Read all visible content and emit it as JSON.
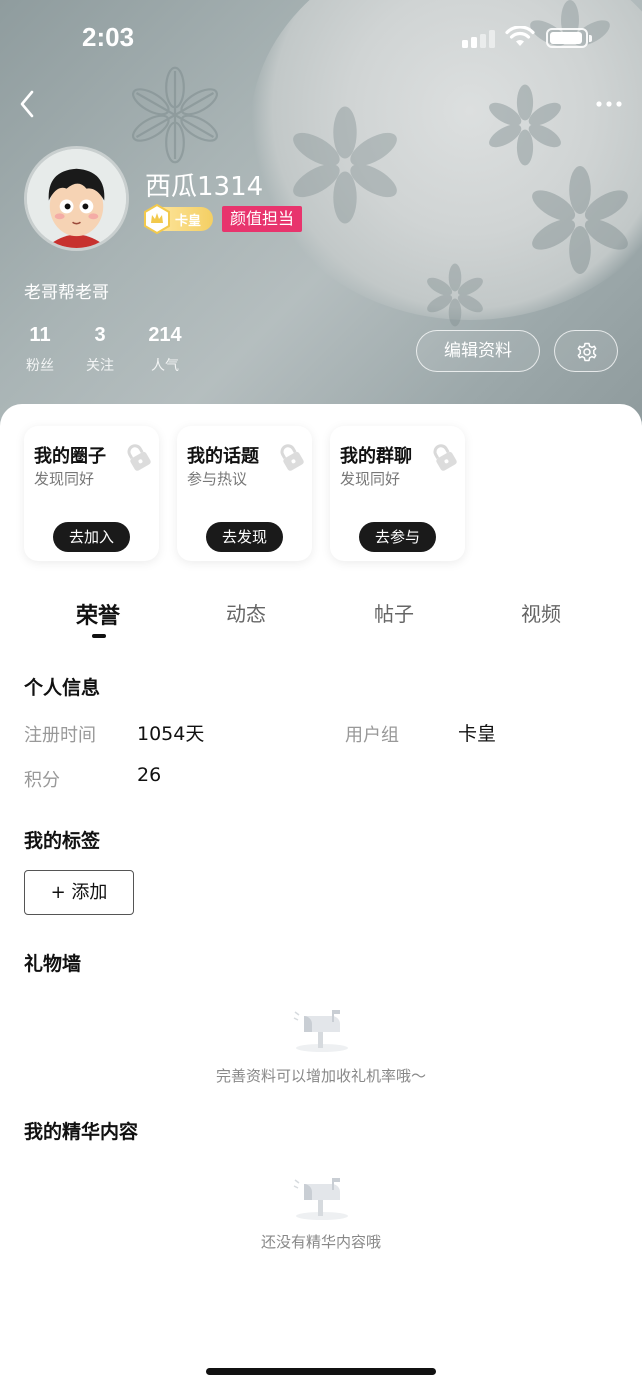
{
  "status_bar": {
    "time": "2:03"
  },
  "profile": {
    "username": "西瓜1314",
    "vip_badge": "卡皇",
    "honor_badge": "颜值担当",
    "bio": "老哥帮老哥",
    "stats": [
      {
        "value": "11",
        "label": "粉丝"
      },
      {
        "value": "3",
        "label": "关注"
      },
      {
        "value": "214",
        "label": "人气"
      }
    ],
    "edit_label": "编辑资料"
  },
  "cards": [
    {
      "title": "我的圈子",
      "subtitle": "发现同好",
      "button": "去加入"
    },
    {
      "title": "我的话题",
      "subtitle": "参与热议",
      "button": "去发现"
    },
    {
      "title": "我的群聊",
      "subtitle": "发现同好",
      "button": "去参与"
    }
  ],
  "tabs": [
    "荣誉",
    "动态",
    "帖子",
    "视频"
  ],
  "personal_info": {
    "title": "个人信息",
    "register_label": "注册时间",
    "register_value": "1054天",
    "group_label": "用户组",
    "group_value": "卡皇",
    "points_label": "积分",
    "points_value": "26"
  },
  "tags": {
    "title": "我的标签",
    "add_label": "+ 添加"
  },
  "gift_wall": {
    "title": "礼物墙",
    "empty_text": "完善资料可以增加收礼机率哦～"
  },
  "featured": {
    "title": "我的精华内容",
    "empty_text": "还没有精华内容哦"
  },
  "icons": [
    "back-icon",
    "more-icon",
    "gear-icon",
    "lock-icon",
    "mailbox-icon",
    "crown-icon"
  ]
}
